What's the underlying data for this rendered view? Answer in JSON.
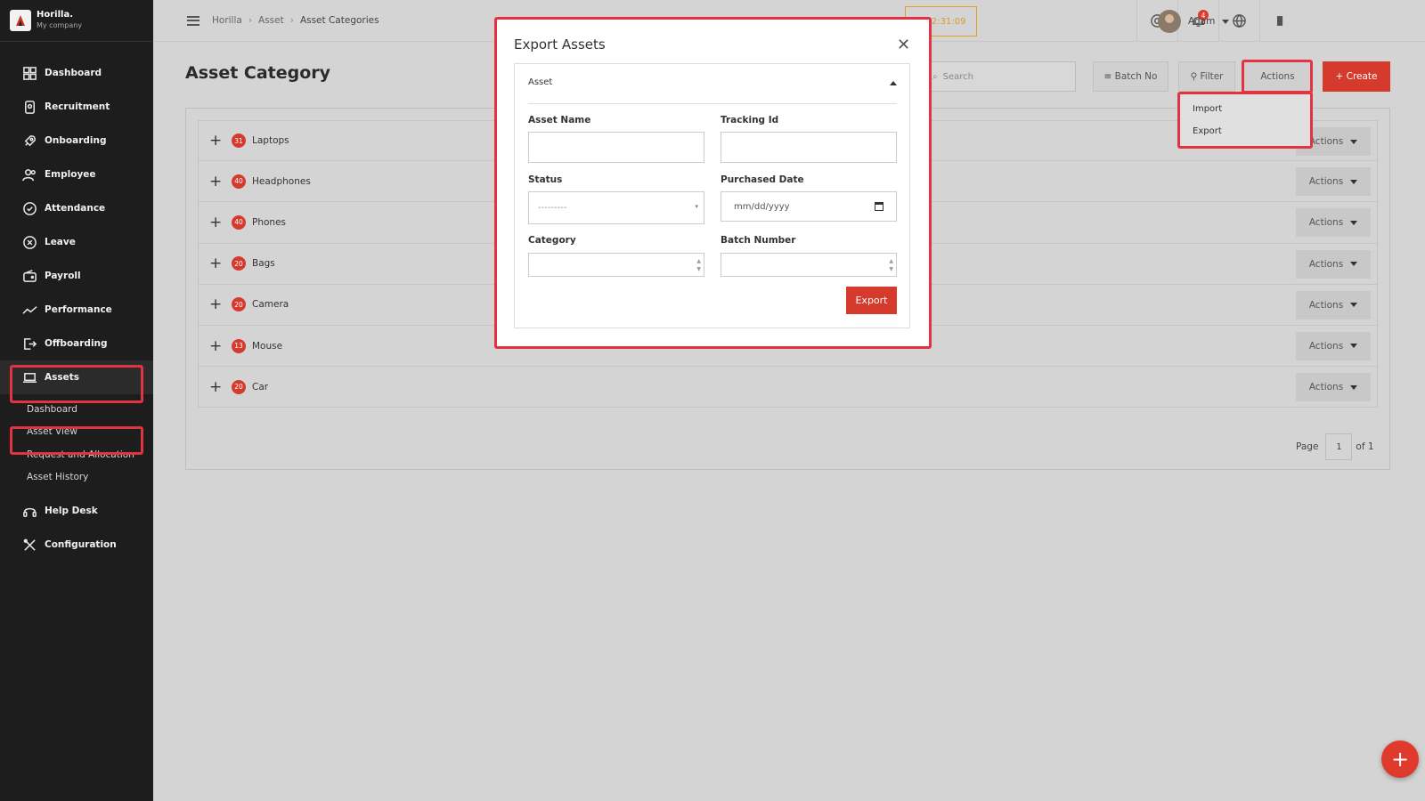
{
  "brand": {
    "name": "Horilla.",
    "company": "My company"
  },
  "sidebar": {
    "items": [
      {
        "label": "Dashboard",
        "icon": "dashboard-icon"
      },
      {
        "label": "Recruitment",
        "icon": "recruitment-icon"
      },
      {
        "label": "Onboarding",
        "icon": "rocket-icon"
      },
      {
        "label": "Employee",
        "icon": "users-icon"
      },
      {
        "label": "Attendance",
        "icon": "check-circle-icon"
      },
      {
        "label": "Leave",
        "icon": "x-circle-icon"
      },
      {
        "label": "Payroll",
        "icon": "wallet-icon"
      },
      {
        "label": "Performance",
        "icon": "trend-icon"
      },
      {
        "label": "Offboarding",
        "icon": "exit-icon"
      },
      {
        "label": "Assets",
        "icon": "laptop-icon"
      }
    ],
    "asset_sub": [
      "Dashboard",
      "Asset View",
      "Request and Allocation",
      "Asset History"
    ],
    "bottom_items": [
      {
        "label": "Help Desk",
        "icon": "headset-icon"
      },
      {
        "label": "Configuration",
        "icon": "tools-icon"
      }
    ]
  },
  "topbar": {
    "breadcrumbs": [
      "Horilla",
      "Asset",
      "Asset Categories"
    ],
    "timer": "⏲ 02:31:09",
    "notification_count": "4",
    "user_name": "Adam"
  },
  "page": {
    "title": "Asset Category",
    "search_placeholder": "Search",
    "batch_label": "≡ Batch No",
    "filter_label": "⚲ Filter",
    "actions_label": "Actions",
    "create_label": "+ Create",
    "dropdown": [
      "Import",
      "Export"
    ]
  },
  "categories": [
    {
      "count": "31",
      "name": "Laptops"
    },
    {
      "count": "40",
      "name": "Headphones"
    },
    {
      "count": "40",
      "name": "Phones"
    },
    {
      "count": "20",
      "name": "Bags"
    },
    {
      "count": "20",
      "name": "Camera"
    },
    {
      "count": "13",
      "name": "Mouse"
    },
    {
      "count": "20",
      "name": "Car"
    }
  ],
  "row_action_label": "Actions",
  "pager": {
    "label": "Page",
    "current": "1",
    "of": "of 1"
  },
  "modal": {
    "title": "Export Assets",
    "section": "Asset",
    "fields": {
      "asset_name": "Asset Name",
      "tracking_id": "Tracking Id",
      "status": "Status",
      "status_value": "---------",
      "purchased_date": "Purchased Date",
      "date_placeholder": "mm/dd/yyyy",
      "category": "Category",
      "batch_number": "Batch Number"
    },
    "export_label": "Export"
  },
  "colors": {
    "accent": "#d53a2d",
    "highlight": "#e13340",
    "sidebar": "#1d1d1d"
  }
}
